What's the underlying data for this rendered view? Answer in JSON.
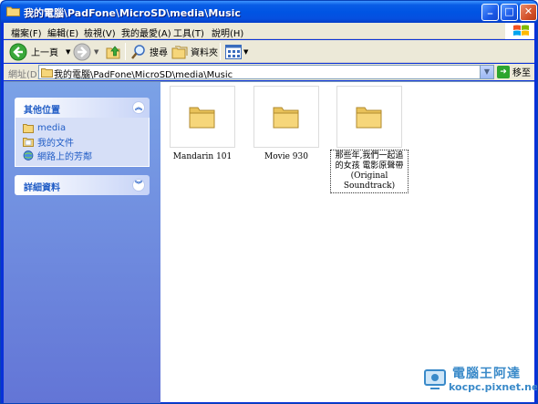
{
  "window": {
    "title": "我的電腦\\PadFone\\MicroSD\\media\\Music",
    "controls": {
      "minimize": "_",
      "maximize": "□",
      "close": "✕"
    }
  },
  "menubar": {
    "items": [
      {
        "label": "檔案(F)"
      },
      {
        "label": "編輯(E)"
      },
      {
        "label": "檢視(V)"
      },
      {
        "label": "我的最愛(A)"
      },
      {
        "label": "工具(T)"
      },
      {
        "label": "說明(H)"
      }
    ]
  },
  "toolbar": {
    "back_label": "上一頁",
    "search_label": "搜尋",
    "folders_label": "資料夾"
  },
  "address": {
    "label": "網址(D)",
    "value": "我的電腦\\PadFone\\MicroSD\\media\\Music",
    "go_label": "移至"
  },
  "sidebar": {
    "other_places": {
      "title": "其他位置",
      "items": [
        {
          "label": "media",
          "icon": "folder-icon"
        },
        {
          "label": "我的文件",
          "icon": "documents-icon"
        },
        {
          "label": "網路上的芳鄰",
          "icon": "network-icon"
        }
      ]
    },
    "details": {
      "title": "詳細資料"
    }
  },
  "folders": [
    {
      "name": "Mandarin 101"
    },
    {
      "name": "Movie 930"
    },
    {
      "name": "那些年,我們一起追的女孩 電影原聲帶(Original Soundtrack)"
    }
  ],
  "watermark": {
    "line1": "電腦王阿達",
    "line2": "kocpc.pixnet.net"
  },
  "colors": {
    "titlebar": "#0054e3",
    "sidebar": "#7ba2e7",
    "link": "#215dc6",
    "folder": "#f6d67a"
  }
}
